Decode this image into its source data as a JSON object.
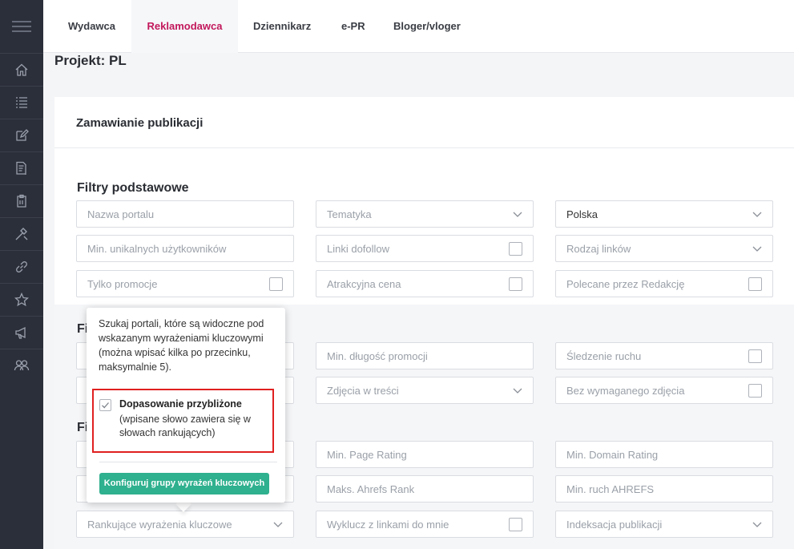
{
  "nav": {
    "tabs": [
      {
        "label": "Wydawca"
      },
      {
        "label": "Reklamodawca"
      },
      {
        "label": "Dziennikarz"
      },
      {
        "label": "e-PR"
      },
      {
        "label": "Bloger/vloger"
      }
    ],
    "active_tab": "Reklamodawca"
  },
  "sidebar": {
    "icons": [
      "menu-icon",
      "home-icon",
      "list-icon",
      "edit-icon",
      "invoice-icon",
      "clipboard-icon",
      "tools-icon",
      "link-icon",
      "star-icon",
      "megaphone-icon",
      "users-icon"
    ]
  },
  "page": {
    "title": "Projekt: PL",
    "card_title": "Zamawianie publikacji"
  },
  "filters": {
    "basic_title": "Filtry podstawowe",
    "section2_title_partial": "Fi",
    "section3_title_partial": "Fi",
    "portal_name_placeholder": "Nazwa portalu",
    "topic_placeholder": "Tematyka",
    "country_value": "Polska",
    "min_unique_users_placeholder": "Min. unikalnych użytkowników",
    "dofollow_label": "Linki dofollow",
    "link_type_placeholder": "Rodzaj linków",
    "promo_only_label": "Tylko promocje",
    "attractive_price_label": "Atrakcyjna cena",
    "recommended_label": "Polecane przez Redakcję",
    "min_promo_length_placeholder": "Min. długość promocji",
    "traffic_tracking_label": "Śledzenie ruchu",
    "images_in_content_placeholder": "Zdjęcia w treści",
    "no_image_required_label": "Bez wymaganego zdjęcia",
    "min_page_rating_placeholder": "Min. Page Rating",
    "min_domain_rating_placeholder": "Min. Domain Rating",
    "max_ahrefs_rank_placeholder": "Maks. Ahrefs Rank",
    "min_ahrefs_traffic_placeholder": "Min. ruch AHREFS",
    "ranking_keywords_placeholder": "Rankujące wyrażenia kluczowe",
    "exclude_links_label": "Wyklucz z linkami do mnie",
    "indexing_placeholder": "Indeksacja publikacji"
  },
  "popover": {
    "text": "Szukaj portali, które są widoczne pod wskazanym wyrażeniami kluczowymi (można wpisać kilka po przecinku, maksymalnie 5).",
    "checkbox_title": "Dopasowanie przybliżone",
    "checkbox_desc": "(wpisane słowo zawiera się w słowach rankujących)",
    "checkbox_checked": true,
    "button_label": "Konfiguruj grupy wyrażeń kluczowych"
  },
  "colors": {
    "sidebar_bg": "#2b2f3a",
    "active_tab": "#c2185b",
    "button_green": "#2fb08e",
    "highlight_red": "#e02020"
  }
}
